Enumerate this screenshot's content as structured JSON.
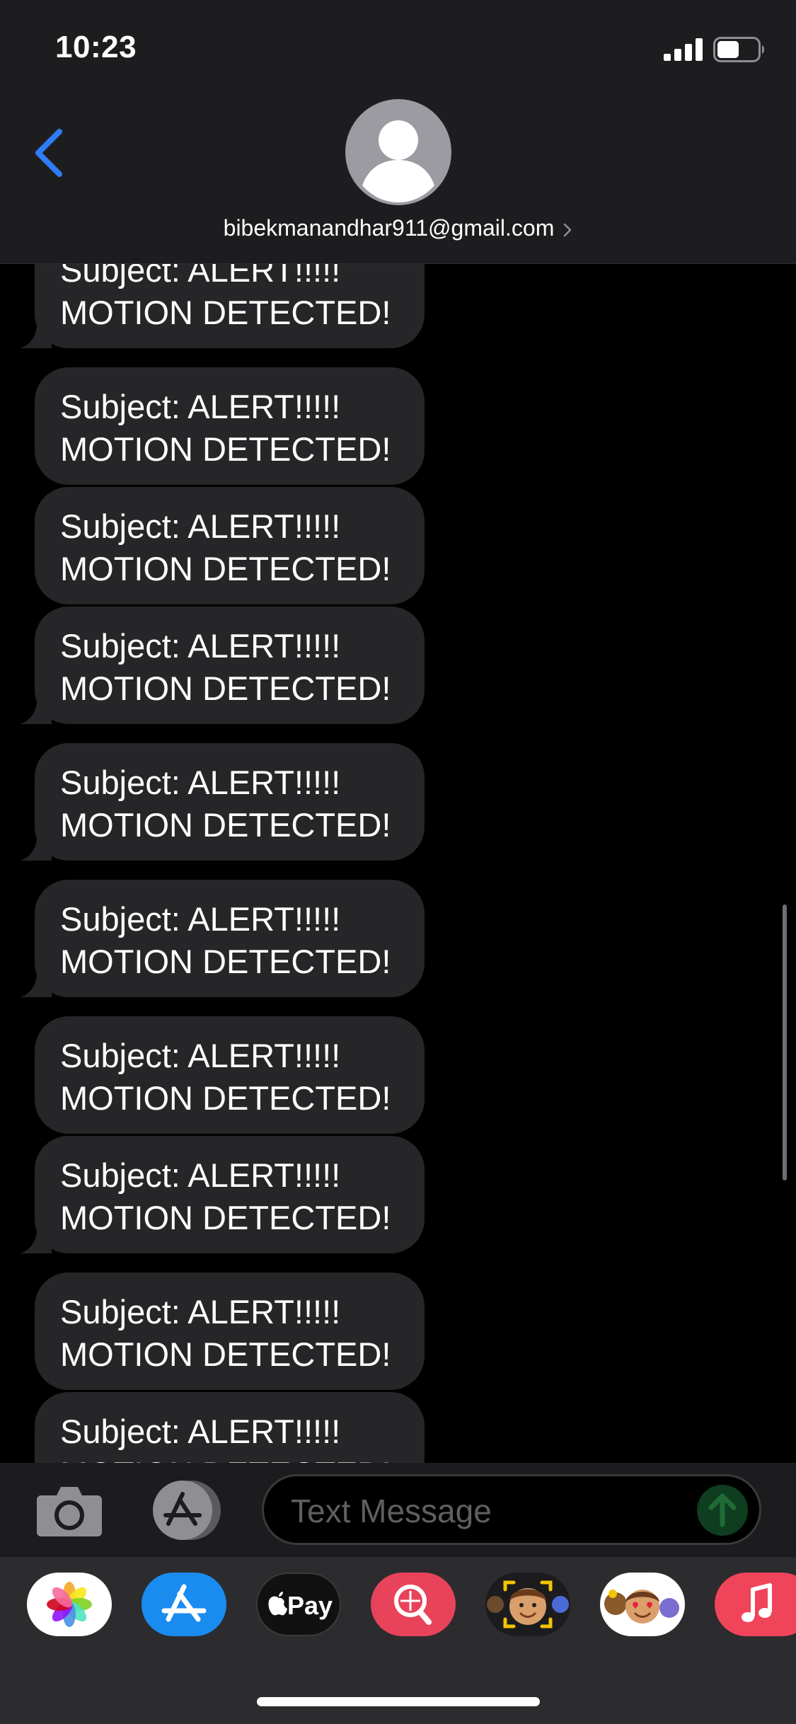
{
  "status_bar": {
    "time": "10:23"
  },
  "header": {
    "contact": "bibekmanandhar911@gmail.com"
  },
  "messages": [
    {
      "line1": "Subject: ALERT!!!!!",
      "line2": "MOTION DETECTED!"
    },
    {
      "line1": "Subject: ALERT!!!!!",
      "line2": "MOTION DETECTED!"
    },
    {
      "line1": "Subject: ALERT!!!!!",
      "line2": "MOTION DETECTED!"
    },
    {
      "line1": "Subject: ALERT!!!!!",
      "line2": "MOTION DETECTED!"
    },
    {
      "line1": "Subject: ALERT!!!!!",
      "line2": "MOTION DETECTED!"
    },
    {
      "line1": "Subject: ALERT!!!!!",
      "line2": "MOTION DETECTED!"
    },
    {
      "line1": "Subject: ALERT!!!!!",
      "line2": "MOTION DETECTED!"
    },
    {
      "line1": "Subject: ALERT!!!!!",
      "line2": "MOTION DETECTED!"
    },
    {
      "line1": "Subject: ALERT!!!!!",
      "line2": "MOTION DETECTED!"
    },
    {
      "line1": "Subject: ALERT!!!!!",
      "line2": "MOTION DETECTED!"
    }
  ],
  "composer": {
    "placeholder": "Text Message"
  },
  "app_drawer": {
    "apps": [
      {
        "name": "photos-app-icon"
      },
      {
        "name": "app-store-app-icon"
      },
      {
        "name": "apple-pay-app-icon",
        "label": "Pay"
      },
      {
        "name": "image-search-app-icon"
      },
      {
        "name": "memoji-camera-app-icon"
      },
      {
        "name": "memoji-stickers-app-icon"
      },
      {
        "name": "music-app-icon"
      }
    ]
  },
  "colors": {
    "accent": "#2f7cf6",
    "bubble": "#262628",
    "header": "#1d1d1f",
    "send_button": "#0f3d1f"
  }
}
